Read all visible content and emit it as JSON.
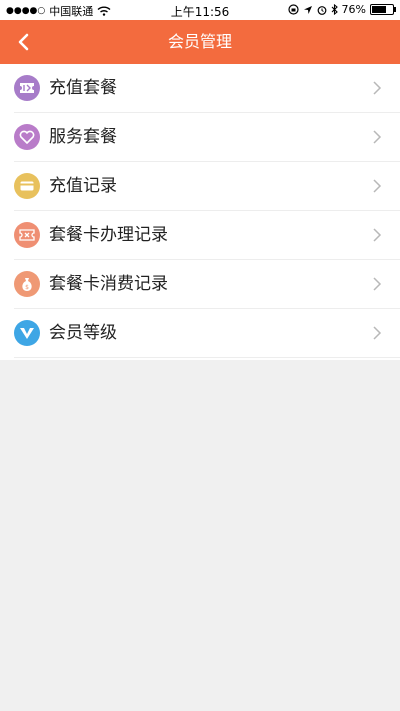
{
  "status_bar": {
    "signal": "●●●●○",
    "carrier": "中国联通",
    "time": "上午11:56",
    "battery_percent": "76%",
    "battery_level": 0.76
  },
  "nav": {
    "title": "会员管理"
  },
  "menu": {
    "items": [
      {
        "label": "充值套餐",
        "icon": "ticket-icon",
        "color": "#a77cc9"
      },
      {
        "label": "服务套餐",
        "icon": "heart-icon",
        "color": "#b97cc9"
      },
      {
        "label": "充值记录",
        "icon": "card-icon",
        "color": "#e8c15d"
      },
      {
        "label": "套餐卡办理记录",
        "icon": "coupon-icon",
        "color": "#ef8f73"
      },
      {
        "label": "套餐卡消费记录",
        "icon": "money-bag-icon",
        "color": "#ef9975"
      },
      {
        "label": "会员等级",
        "icon": "vip-icon",
        "color": "#3ea6e5"
      }
    ]
  },
  "colors": {
    "accent": "#f36b3e",
    "background": "#f0f0f0"
  }
}
